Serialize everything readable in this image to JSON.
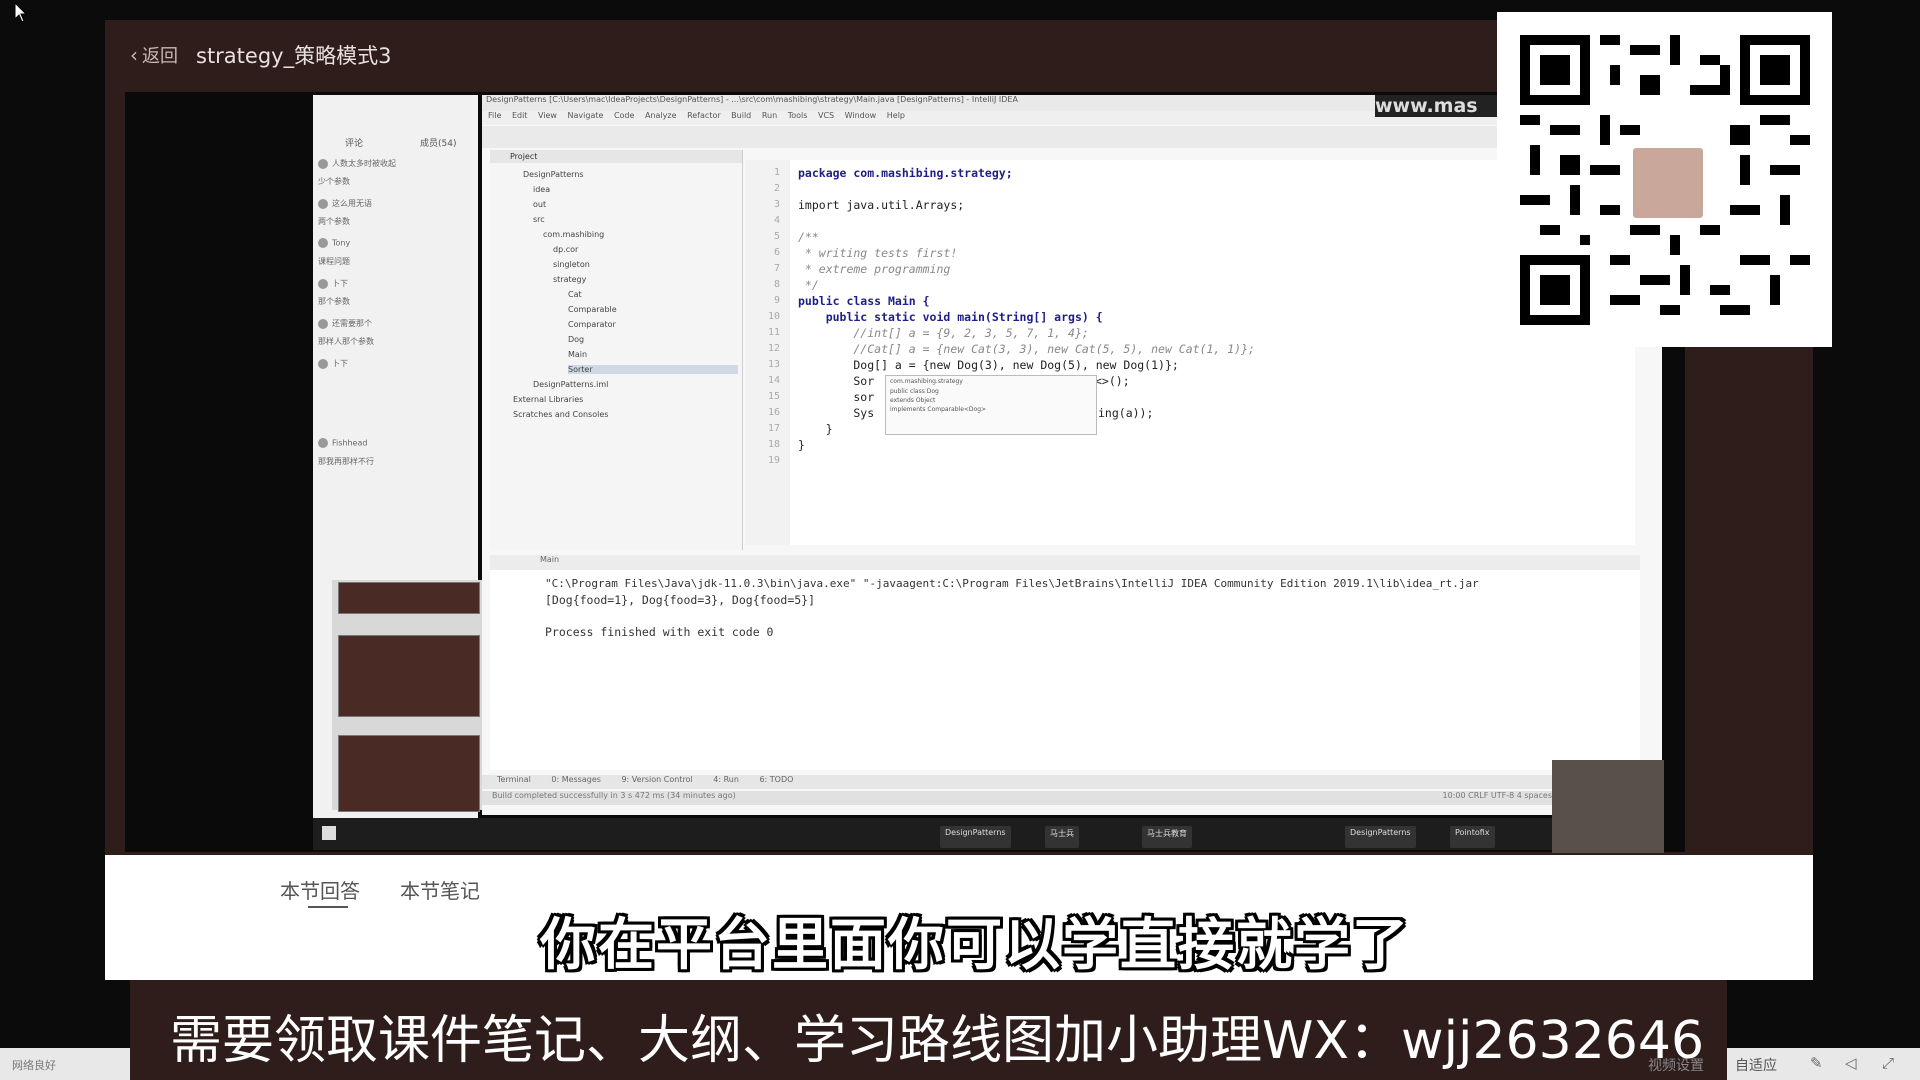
{
  "player": {
    "back_label": "返回",
    "title": "strategy_策略模式3",
    "watermark": "www.mas"
  },
  "sidebar": {
    "tab_left": "评论",
    "tab_right": "成员(54)",
    "items": [
      "人数太多时被收起",
      "少个参数",
      "这么用无语",
      "两个参数",
      "Tony",
      "课程问题",
      "卜下",
      "那个参数",
      "还需要那个",
      "那样人那个参数",
      "卜下",
      "Fishhead",
      "那我再那样不行"
    ]
  },
  "ide": {
    "title": "DesignPatterns [C:\\Users\\mac\\IdeaProjects\\DesignPatterns] - ...\\src\\com\\mashibing\\strategy\\Main.java [DesignPatterns] - IntelliJ IDEA",
    "menu": [
      "File",
      "Edit",
      "View",
      "Navigate",
      "Code",
      "Analyze",
      "Refactor",
      "Build",
      "Run",
      "Tools",
      "VCS",
      "Window",
      "Help"
    ],
    "project_label": "Project",
    "tree": [
      "DesignPatterns",
      "idea",
      "out",
      "src",
      "com.mashibing",
      "dp.cor",
      "singleton",
      "strategy",
      "Cat",
      "Comparable",
      "Comparator",
      "Dog",
      "Main",
      "Sorter",
      "DesignPatterns.iml",
      "External Libraries",
      "Scratches and Consoles"
    ],
    "line_numbers": [
      "1",
      "2",
      "3",
      "4",
      "5",
      "6",
      "7",
      "8",
      "9",
      "10",
      "11",
      "12",
      "13",
      "14",
      "15",
      "16",
      "17",
      "18",
      "19"
    ],
    "code": {
      "l1": "package com.mashibing.strategy;",
      "l3": "import java.util.Arrays;",
      "l5": "/**",
      "l6": " * writing tests first!",
      "l7": " * extreme programming",
      "l8": " */",
      "l9": "public class Main {",
      "l10": "    public static void main(String[] args) {",
      "l11": "        //int[] a = {9, 2, 3, 5, 7, 1, 4};",
      "l12": "        //Cat[] a = {new Cat(3, 3), new Cat(5, 5), new Cat(1, 1)};",
      "l13": "        Dog[] a = {new Dog(3), new Dog(5), new Dog(1)};",
      "l14": "        Sor",
      "l14r": "<>();",
      "l15": "        sor",
      "l16": "        Sys",
      "l16r": "ing(a));",
      "l17": "    }",
      "l18": "}"
    },
    "autocomplete": [
      "com.mashibing.strategy",
      "public class Dog",
      "extends Object",
      "implements Comparable<Dog>"
    ],
    "run_tab": "Main",
    "console": {
      "line1": "\"C:\\Program Files\\Java\\jdk-11.0.3\\bin\\java.exe\" \"-javaagent:C:\\Program Files\\JetBrains\\IntelliJ IDEA Community Edition 2019.1\\lib\\idea_rt.jar",
      "line2": "[Dog{food=1}, Dog{food=3}, Dog{food=5}]",
      "line3": "Process finished with exit code 0"
    },
    "tool_windows": [
      "Terminal",
      "0: Messages",
      "9: Version Control",
      "4: Run",
      "6: TODO"
    ],
    "status": "Build completed successfully in 3 s 472 ms (34 minutes ago)",
    "status_right": "10:00  CRLF  UTF-8  4 spaces"
  },
  "taskbar": [
    "DesignPatterns",
    "马士兵",
    "马士兵教育",
    "DesignPatterns",
    "Pointofix"
  ],
  "lower": {
    "tab_qa": "本节回答",
    "tab_notes": "本节笔记"
  },
  "subtitle": "你在平台里面你可以学直接就学了",
  "banner": "需要领取课件笔记、大纲、学习路线图加小助理WX：wjj2632646",
  "bottom": {
    "left_text": "网络良好",
    "settings": "视频设置",
    "adapt": "自适应"
  }
}
